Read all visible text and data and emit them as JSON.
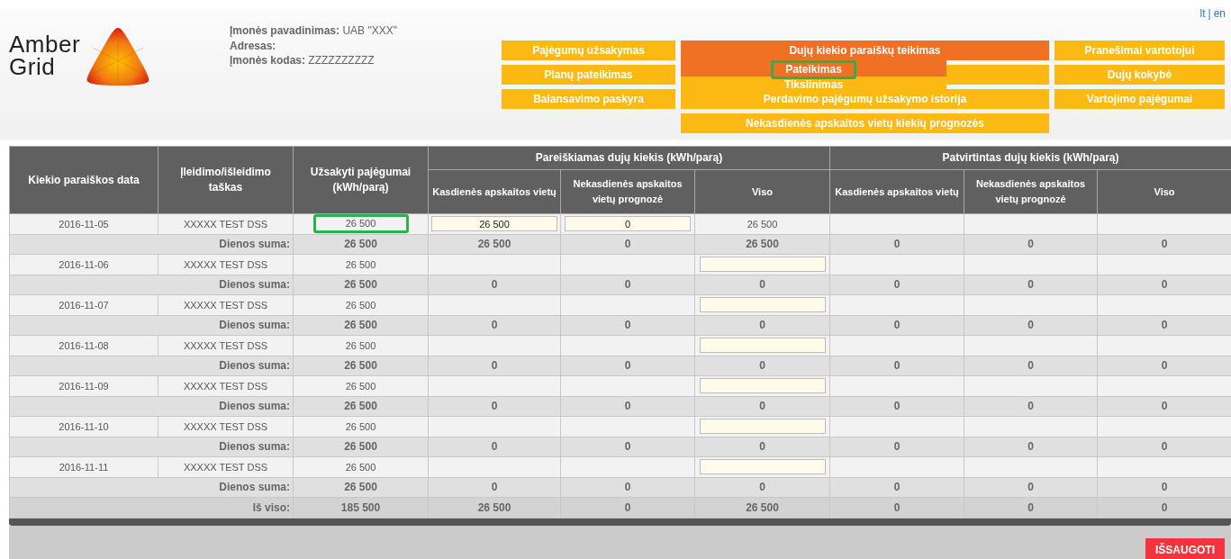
{
  "languages": {
    "items": [
      {
        "label": "lt"
      },
      {
        "label": "en"
      }
    ],
    "separator": "|"
  },
  "logo": {
    "text": "Amber Grid"
  },
  "company": [
    "**Įmonės pavadinimas:** UAB \"XXX\"",
    "**Adresas:**",
    "**Įmonės kodas:** ZZZZZZZZZZ"
  ],
  "menu": {
    "columns": [
      {
        "items": [
          {
            "label": "Pajėgumų užsakymas",
            "active": false
          },
          {
            "label": "Planų pateikimas",
            "active": false
          },
          {
            "label": "Balansavimo paskyra",
            "active": false
          }
        ]
      },
      {
        "items": [
          {
            "label": "Dujų kiekio paraiškų teikimas",
            "active": true,
            "submenu": [
              {
                "label": "Pateikimas",
                "selected": true,
                "highlighted": true
              },
              {
                "label": "Tikslinimas",
                "selected": false,
                "highlighted": false
              }
            ]
          },
          {
            "active": false
          },
          {
            "label": "Perdavimo pajėgumų užsakymo istorija",
            "active": false
          },
          {
            "label": "Nekasdienės apskaitos vietų kiekių prognozės",
            "active": false
          }
        ]
      },
      {
        "items": [
          {
            "label": "Pranešimai vartotojui",
            "active": false
          },
          {
            "label": "Dujų kokybė",
            "active": false
          },
          {
            "label": "Vartojimo pajėgumai",
            "active": false
          }
        ]
      }
    ]
  },
  "table": {
    "columns": [
      "Kiekio paraiškos data",
      "Įleidimo/išleidimo taškas",
      "Užsakyti pajėgumai (kWh/parą)"
    ],
    "groups": [
      {
        "label": "Pareiškiamas dujų kiekis (kWh/parą)",
        "columns": [
          "Kasdienės apskaitos vietų",
          "Nekasdienės apskaitos vietų prognozė",
          "Viso"
        ]
      },
      {
        "label": "Patvirtintas dujų kiekis (kWh/parą)",
        "columns": [
          "Kasdienės apskaitos vietų",
          "Nekasdienės apskaitos vietų prognozė",
          "Viso"
        ]
      }
    ],
    "rows": [
      {
        "kind": "entry",
        "date": "2016-11-05",
        "point": "XXXXX TEST DSS",
        "capacity": "26 500",
        "highlighted": true,
        "cells": [
          {
            "kind": "input",
            "value": "26 500"
          },
          {
            "kind": "input",
            "value": "0"
          },
          {
            "kind": "text",
            "value": "26 500"
          },
          {
            "kind": "empty"
          },
          {
            "kind": "empty"
          },
          {
            "kind": "empty"
          }
        ]
      },
      {
        "kind": "sum",
        "label": "Dienos suma:",
        "values": [
          "26 500",
          "26 500",
          "0",
          "26 500",
          "0",
          "0",
          "0"
        ]
      },
      {
        "kind": "entry",
        "date": "2016-11-06",
        "point": "XXXXX TEST DSS",
        "capacity": "26 500",
        "highlighted": false,
        "cells": [
          {
            "kind": "empty"
          },
          {
            "kind": "empty"
          },
          {
            "kind": "input"
          },
          {
            "kind": "empty"
          },
          {
            "kind": "empty"
          },
          {
            "kind": "empty"
          }
        ]
      },
      {
        "kind": "sum",
        "label": "Dienos suma:",
        "values": [
          "26 500",
          "0",
          "0",
          "0",
          "0",
          "0",
          "0"
        ]
      },
      {
        "kind": "entry",
        "date": "2016-11-07",
        "point": "XXXXX TEST DSS",
        "capacity": "26 500",
        "highlighted": false,
        "cells": [
          {
            "kind": "empty"
          },
          {
            "kind": "empty"
          },
          {
            "kind": "input"
          },
          {
            "kind": "empty"
          },
          {
            "kind": "empty"
          },
          {
            "kind": "empty"
          }
        ]
      },
      {
        "kind": "sum",
        "label": "Dienos suma:",
        "values": [
          "26 500",
          "0",
          "0",
          "0",
          "0",
          "0",
          "0"
        ]
      },
      {
        "kind": "entry",
        "date": "2016-11-08",
        "point": "XXXXX TEST DSS",
        "capacity": "26 500",
        "highlighted": false,
        "cells": [
          {
            "kind": "empty"
          },
          {
            "kind": "empty"
          },
          {
            "kind": "input"
          },
          {
            "kind": "empty"
          },
          {
            "kind": "empty"
          },
          {
            "kind": "empty"
          }
        ]
      },
      {
        "kind": "sum",
        "label": "Dienos suma:",
        "values": [
          "26 500",
          "0",
          "0",
          "0",
          "0",
          "0",
          "0"
        ]
      },
      {
        "kind": "entry",
        "date": "2016-11-09",
        "point": "XXXXX TEST DSS",
        "capacity": "26 500",
        "highlighted": false,
        "cells": [
          {
            "kind": "empty"
          },
          {
            "kind": "empty"
          },
          {
            "kind": "input"
          },
          {
            "kind": "empty"
          },
          {
            "kind": "empty"
          },
          {
            "kind": "empty"
          }
        ]
      },
      {
        "kind": "sum",
        "label": "Dienos suma:",
        "values": [
          "26 500",
          "0",
          "0",
          "0",
          "0",
          "0",
          "0"
        ]
      },
      {
        "kind": "entry",
        "date": "2016-11-10",
        "point": "XXXXX TEST DSS",
        "capacity": "26 500",
        "highlighted": false,
        "cells": [
          {
            "kind": "empty"
          },
          {
            "kind": "empty"
          },
          {
            "kind": "input"
          },
          {
            "kind": "empty"
          },
          {
            "kind": "empty"
          },
          {
            "kind": "empty"
          }
        ]
      },
      {
        "kind": "sum",
        "label": "Dienos suma:",
        "values": [
          "26 500",
          "0",
          "0",
          "0",
          "0",
          "0",
          "0"
        ]
      },
      {
        "kind": "entry",
        "date": "2016-11-11",
        "point": "XXXXX TEST DSS",
        "capacity": "26 500",
        "highlighted": false,
        "cells": [
          {
            "kind": "empty"
          },
          {
            "kind": "empty"
          },
          {
            "kind": "input"
          },
          {
            "kind": "empty"
          },
          {
            "kind": "empty"
          },
          {
            "kind": "empty"
          }
        ]
      },
      {
        "kind": "sum",
        "label": "Dienos suma:",
        "values": [
          "26 500",
          "0",
          "0",
          "0",
          "0",
          "0",
          "0"
        ]
      },
      {
        "kind": "total",
        "label": "Iš viso:",
        "values": [
          "185 500",
          "26 500",
          "0",
          "26 500",
          "0",
          "0",
          "0"
        ]
      }
    ]
  },
  "save_button": "IŠSAUGOTI"
}
